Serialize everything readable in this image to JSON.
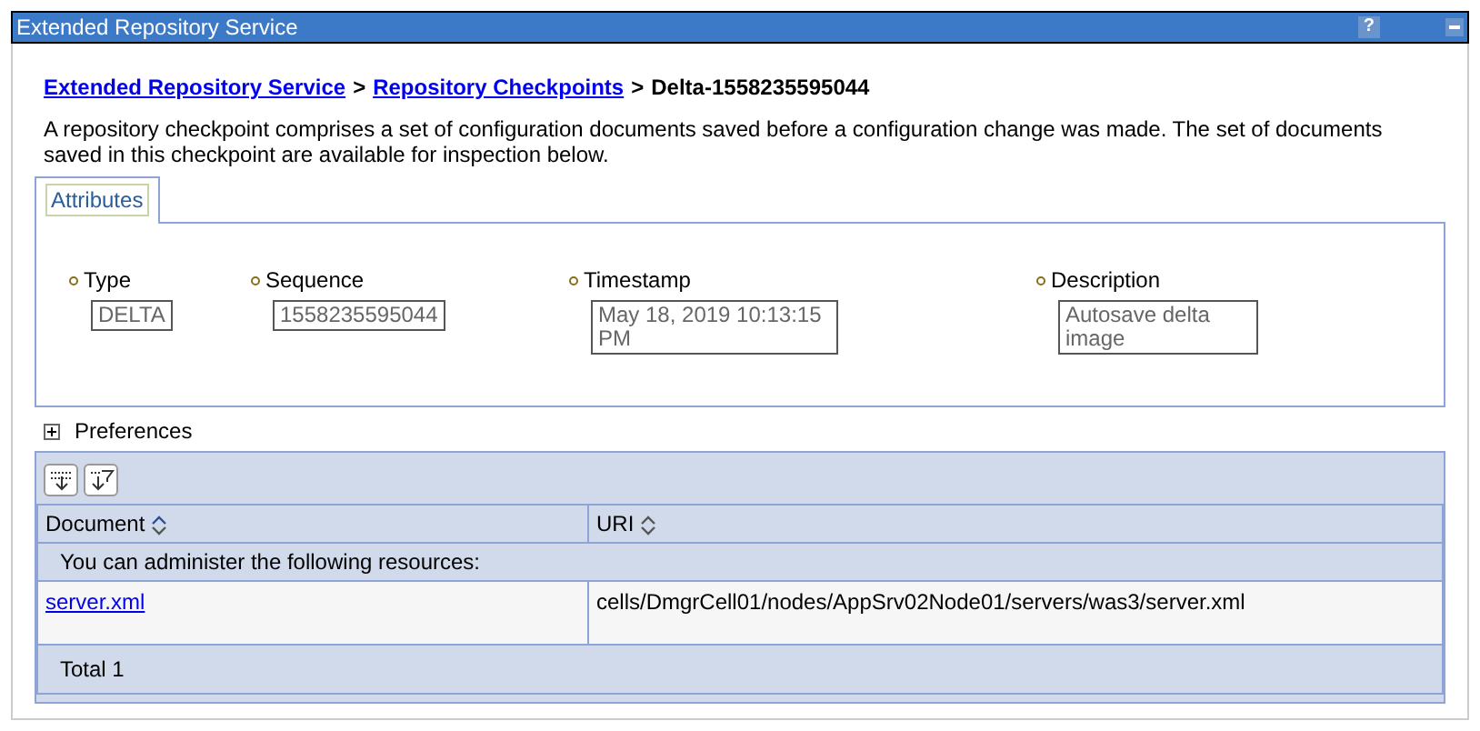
{
  "window": {
    "title": "Extended Repository Service",
    "help": "?"
  },
  "breadcrumb": [
    {
      "label": "Extended Repository Service",
      "kind": "link"
    },
    {
      "label": "Repository Checkpoints",
      "kind": "link"
    },
    {
      "label": "Delta-1558235595044",
      "kind": "current"
    }
  ],
  "separator": ">",
  "description": "A repository checkpoint comprises a set of configuration documents saved before a configuration change was made. The set of documents saved in this checkpoint are available for inspection below.",
  "tabs": [
    {
      "label": "Attributes",
      "selected": true
    }
  ],
  "fields": [
    {
      "label": "Type",
      "value": "DELTA"
    },
    {
      "label": "Sequence",
      "value": "1558235595044"
    },
    {
      "label": "Timestamp",
      "value": "May 18, 2019 10:13:15 PM"
    },
    {
      "label": "Description",
      "value": "Autosave delta image"
    }
  ],
  "preferences": {
    "label": "Preferences",
    "expanded": false
  },
  "table": {
    "columns": [
      {
        "label": "Document",
        "sorted": true
      },
      {
        "label": "URI",
        "sorted": false
      }
    ],
    "notice": "You can administer the following resources:",
    "rows": [
      {
        "document": "server.xml",
        "uri": "cells/DmgrCell01/nodes/AppSrv02Node01/servers/was3/server.xml"
      }
    ],
    "total": "Total 1"
  }
}
